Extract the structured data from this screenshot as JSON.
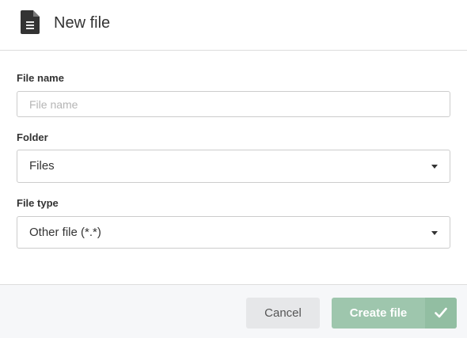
{
  "dialog": {
    "title": "New file",
    "header_icon": "document-icon"
  },
  "form": {
    "file_name": {
      "label": "File name",
      "value": "",
      "placeholder": "File name"
    },
    "folder": {
      "label": "Folder",
      "selected": "Files"
    },
    "file_type": {
      "label": "File type",
      "selected": "Other file (*.*)"
    }
  },
  "footer": {
    "cancel_label": "Cancel",
    "create_label": "Create file",
    "create_icon": "checkmark-icon"
  },
  "colors": {
    "create_button": "#9ec6ad",
    "cancel_button": "#e6e7e9",
    "footer_background": "#f6f7f9"
  }
}
